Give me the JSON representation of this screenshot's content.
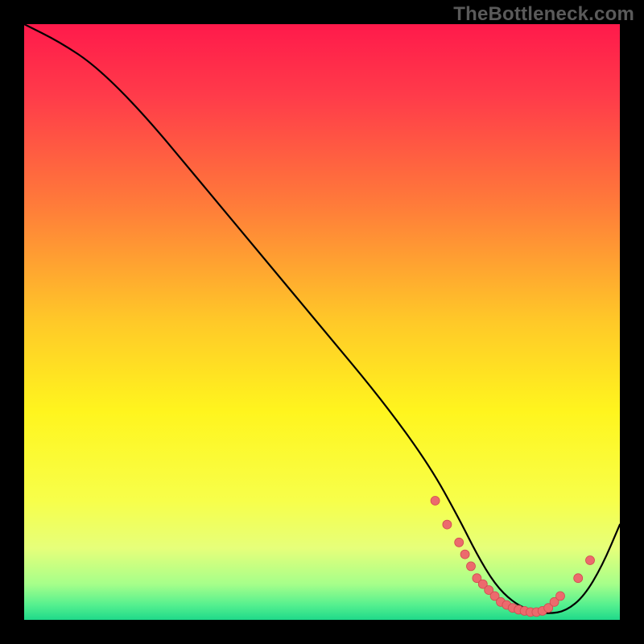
{
  "watermark": "TheBottleneck.com",
  "chart_data": {
    "type": "line",
    "title": "",
    "xlabel": "",
    "ylabel": "",
    "xlim": [
      0,
      100
    ],
    "ylim": [
      0,
      100
    ],
    "series": [
      {
        "name": "curve",
        "x": [
          0,
          6,
          12,
          20,
          30,
          40,
          50,
          60,
          68,
          73,
          76,
          79,
          82,
          85,
          88,
          91,
          94,
          97,
          100
        ],
        "y": [
          100,
          97,
          93,
          85,
          73,
          61,
          49,
          37,
          26,
          17,
          11,
          6,
          3,
          1.5,
          1.0,
          1.5,
          4,
          9,
          16
        ]
      }
    ],
    "marker_cluster": {
      "name": "flat-bottom markers",
      "x": [
        69,
        71,
        73,
        74,
        75,
        76,
        77,
        78,
        79,
        80,
        81,
        82,
        83,
        84,
        85,
        86,
        87,
        88,
        89,
        90,
        93,
        95
      ],
      "y": [
        20,
        16,
        13,
        11,
        9,
        7,
        6,
        5,
        4,
        3,
        2.5,
        2,
        1.7,
        1.5,
        1.3,
        1.3,
        1.5,
        2,
        3,
        4,
        7,
        10
      ]
    },
    "background_gradient": {
      "stops": [
        {
          "offset": 0.0,
          "color": "#ff1a4b"
        },
        {
          "offset": 0.12,
          "color": "#ff3b4a"
        },
        {
          "offset": 0.3,
          "color": "#ff7a3a"
        },
        {
          "offset": 0.5,
          "color": "#ffc928"
        },
        {
          "offset": 0.65,
          "color": "#fff51e"
        },
        {
          "offset": 0.8,
          "color": "#f7ff4a"
        },
        {
          "offset": 0.88,
          "color": "#e6ff7a"
        },
        {
          "offset": 0.94,
          "color": "#a6ff8a"
        },
        {
          "offset": 0.975,
          "color": "#55f08f"
        },
        {
          "offset": 1.0,
          "color": "#1fd98a"
        }
      ]
    },
    "colors": {
      "curve": "#000000",
      "marker_fill": "#ec6a6d",
      "marker_stroke": "#d24a50"
    }
  }
}
